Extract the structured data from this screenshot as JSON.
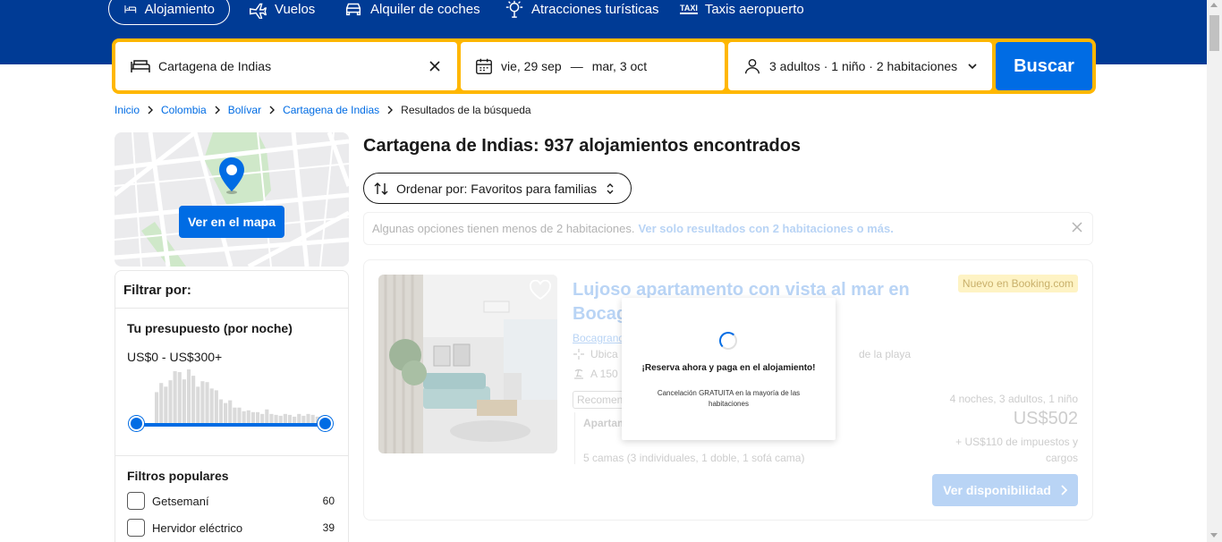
{
  "nav": {
    "tabs": [
      {
        "label": "Alojamiento",
        "icon": "bed-icon",
        "active": true
      },
      {
        "label": "Vuelos",
        "icon": "plane-icon"
      },
      {
        "label": "Alquiler de coches",
        "icon": "car-icon"
      },
      {
        "label": "Atracciones turísticas",
        "icon": "attractions-icon"
      },
      {
        "label": "Taxis aeropuerto",
        "icon": "taxi-icon",
        "icon_text": "TAXI"
      }
    ]
  },
  "search": {
    "destination": "Cartagena de Indias",
    "date_start": "vie, 29 sep",
    "date_sep": "—",
    "date_end": "mar, 3 oct",
    "guests": "3 adultos · 1 niño · 2 habitaciones",
    "button": "Buscar"
  },
  "breadcrumb": {
    "links": [
      "Inicio",
      "Colombia",
      "Bolívar",
      "Cartagena de Indias"
    ],
    "current": "Resultados de la búsqueda"
  },
  "map": {
    "button": "Ver en el mapa"
  },
  "filters": {
    "title": "Filtrar por:",
    "budget_title": "Tu presupuesto (por noche)",
    "budget_range": "US$0 - US$300+",
    "histogram": [
      34,
      44,
      40,
      47,
      57,
      56,
      48,
      59,
      52,
      40,
      46,
      45,
      38,
      36,
      26,
      22,
      25,
      17,
      17,
      13,
      14,
      12,
      12,
      10,
      15,
      10,
      9,
      8,
      10,
      9,
      7,
      10,
      8,
      10,
      9,
      7,
      6
    ],
    "popular_title": "Filtros populares",
    "popular": [
      {
        "label": "Getsemaní",
        "count": "60"
      },
      {
        "label": "Hervidor eléctrico",
        "count": "39"
      }
    ]
  },
  "results": {
    "title": "Cartagena de Indias: 937 alojamientos encontrados",
    "sort_label": "Ordenar por: Favoritos para familias",
    "notice_text": "Algunas opciones tienen menos de 2 habitaciones.",
    "notice_link": "Ver solo resultados con 2 habitaciones o más."
  },
  "card": {
    "title_line1": "Lujoso apartamento con vista al mar en",
    "title_line2": "Bocag",
    "badge": "Nuevo en Booking.com",
    "location": "Bocagrand",
    "location_map": "a",
    "feature1": "Ubica",
    "feature1_tail": "de la playa",
    "feature2": "A 150",
    "recommended": "Recomen",
    "apartment": "Apartam",
    "beds": "5 camas (3 individuales, 1 doble, 1 sofá cama)",
    "nights": "4 noches, 3 adultos, 1 niño",
    "price": "US$502",
    "taxes": "+ US$110 de impuestos y cargos",
    "button": "Ver disponibilidad"
  },
  "popup": {
    "title": "¡Reserva ahora y paga en el alojamiento!",
    "subtitle": "Cancelación GRATUITA en la mayoría de las habitaciones"
  },
  "colors": {
    "brand": "#003b95",
    "accent": "#006ce4",
    "search_border": "#ffb700"
  }
}
